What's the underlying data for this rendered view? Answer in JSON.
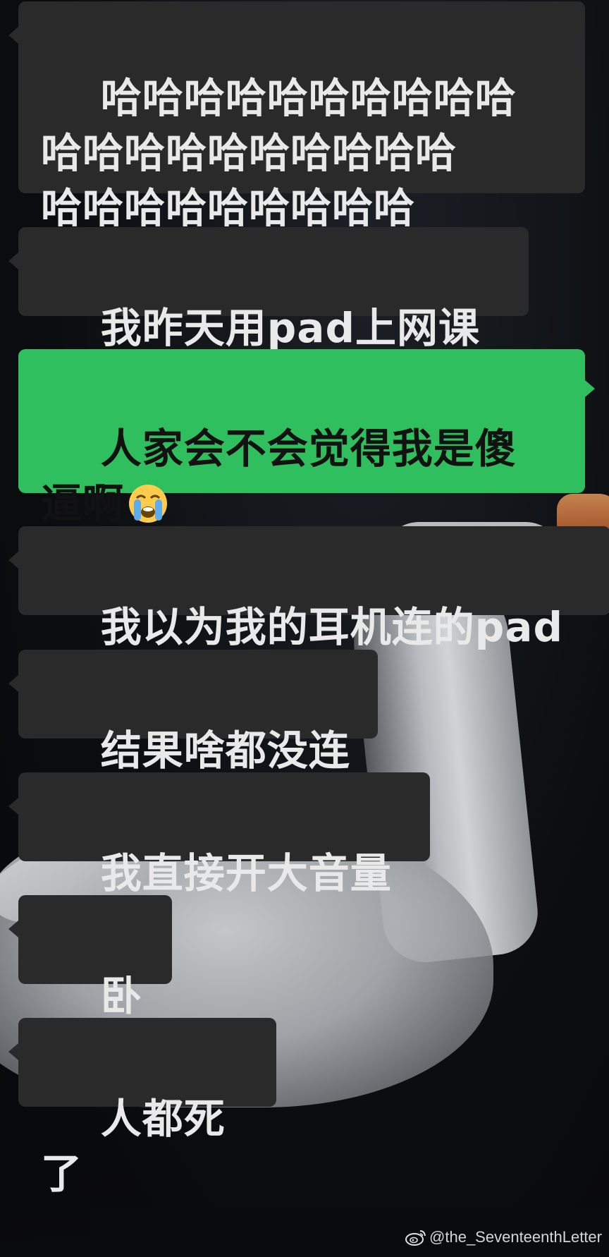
{
  "messages": [
    {
      "direction": "incoming",
      "text": "哈哈哈哈哈哈哈哈哈哈\n哈哈哈哈哈哈哈哈哈哈\n哈哈哈哈哈哈哈哈哈"
    },
    {
      "direction": "incoming",
      "text": "我昨天用pad上网课"
    },
    {
      "direction": "outgoing",
      "text": "人家会不会觉得我是傻\n逼啊",
      "emoji": "loudly-crying-face-emoji"
    },
    {
      "direction": "incoming",
      "text": "我以为我的耳机连的pad"
    },
    {
      "direction": "incoming",
      "text": "结果啥都没连"
    },
    {
      "direction": "incoming",
      "text": "我直接开大音量"
    },
    {
      "direction": "incoming",
      "text": "卧槽"
    },
    {
      "direction": "incoming",
      "text": "人都死了"
    }
  ],
  "watermark": {
    "icon": "weibo-icon",
    "text": "@the_SeventeenthLetter"
  },
  "colors": {
    "incoming_bubble": "#2a2a2a",
    "outgoing_bubble": "#2fbf5e",
    "incoming_text": "#e9e9e9",
    "outgoing_text": "#121212"
  }
}
